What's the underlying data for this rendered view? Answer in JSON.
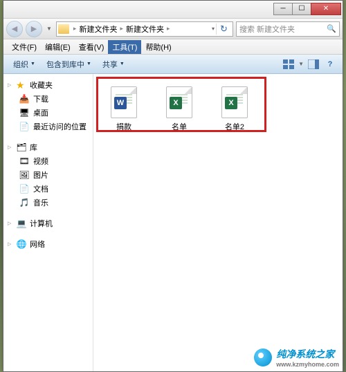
{
  "titlebar": {
    "min": "─",
    "max": "☐",
    "close": "✕"
  },
  "nav": {
    "back": "◀",
    "fwd": "▶"
  },
  "breadcrumb": {
    "seg1": "新建文件夹",
    "seg2": "新建文件夹"
  },
  "search": {
    "placeholder": "搜索 新建文件夹"
  },
  "menu": {
    "file": "文件(F)",
    "edit": "编辑(E)",
    "view": "查看(V)",
    "tools": "工具(T)",
    "help": "帮助(H)"
  },
  "toolbar": {
    "organize": "组织",
    "include": "包含到库中",
    "share": "共享"
  },
  "sidebar": {
    "favorites": "收藏夹",
    "fav_items": [
      "下载",
      "桌面",
      "最近访问的位置"
    ],
    "libraries": "库",
    "lib_items": [
      "视频",
      "图片",
      "文档",
      "音乐"
    ],
    "computer": "计算机",
    "network": "网络"
  },
  "files": [
    {
      "name": "捐款",
      "app": "word",
      "badge": "W"
    },
    {
      "name": "名单",
      "app": "excel",
      "badge": "X"
    },
    {
      "name": "名单2",
      "app": "excel",
      "badge": "X"
    }
  ],
  "watermark": {
    "brand": "纯净系统之家",
    "url": "www.kzmyhome.com"
  }
}
